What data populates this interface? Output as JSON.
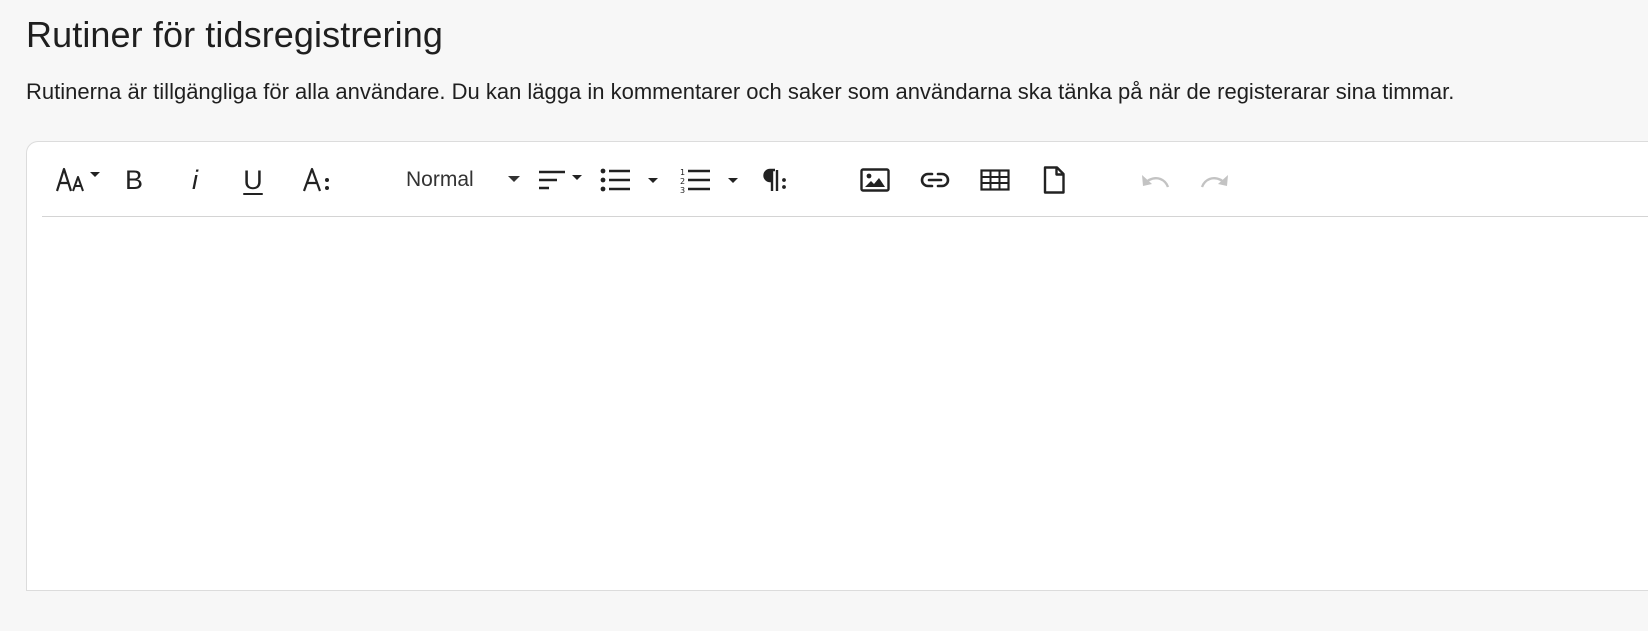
{
  "page": {
    "title": "Rutiner för tidsregistrering",
    "description": "Rutinerna är tillgängliga för alla användare. Du kan lägga in kommentarer och saker som användarna ska tänka på när de registerarar sina timmar."
  },
  "editor": {
    "toolbar": {
      "bold_label": "B",
      "italic_label": "i",
      "underline_label": "U",
      "paragraph_format": "Normal",
      "icons": [
        "font-size-icon",
        "bold-icon",
        "italic-icon",
        "underline-icon",
        "text-color-icon",
        "align-icon",
        "unordered-list-icon",
        "ordered-list-icon",
        "paragraph-icon",
        "image-icon",
        "link-icon",
        "table-icon",
        "file-icon",
        "undo-icon",
        "redo-icon"
      ]
    },
    "content": ""
  },
  "colors": {
    "page_background": "#f7f7f7",
    "editor_background": "#ffffff",
    "border": "#dcdcdc",
    "icon": "#222222",
    "icon_disabled": "#c3c3c3"
  }
}
